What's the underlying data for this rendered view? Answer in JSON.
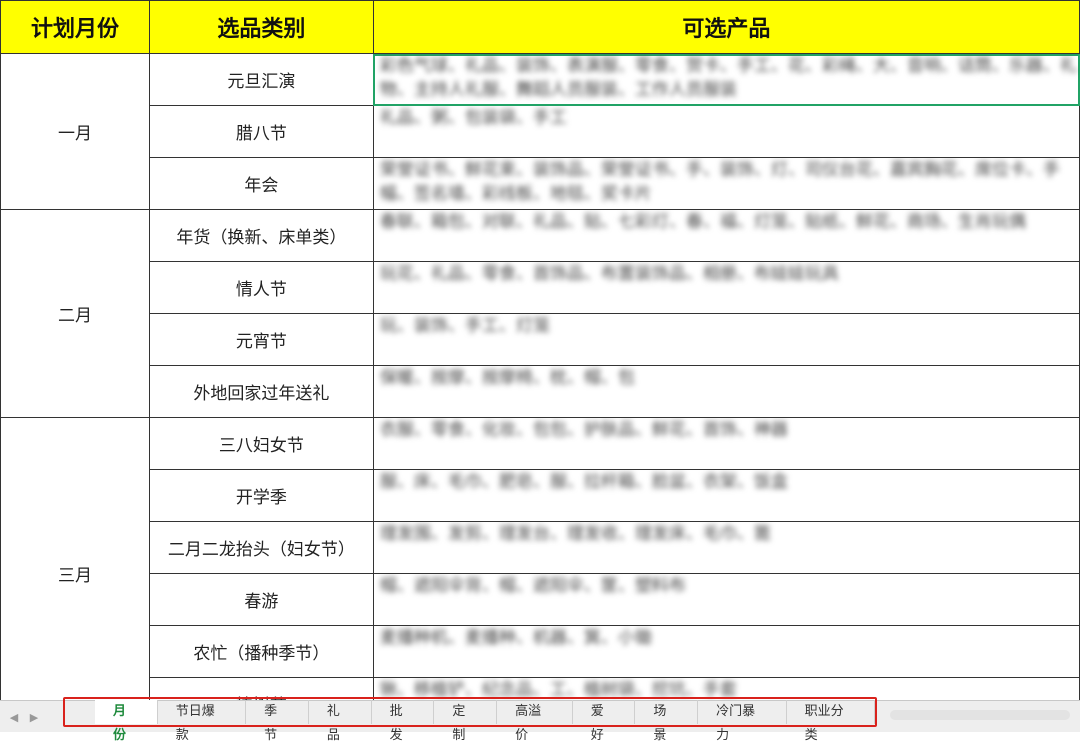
{
  "header": {
    "col_month": "计划月份",
    "col_category": "选品类别",
    "col_products": "可选产品"
  },
  "months": [
    "一月",
    "二月",
    "三月"
  ],
  "rows": [
    {
      "category": "元旦汇演",
      "products": "彩色气球、礼品、装饰、表演服、零食、贺卡、手工、花、彩绳、大、音响、话筒、乐器、礼物、主持人礼服、舞蹈人员服装、工作人员服装"
    },
    {
      "category": "腊八节",
      "products": "礼品、粥、包装袋、手工"
    },
    {
      "category": "年会",
      "products": "荣誉证书、鲜花束、装饰品、荣誉证书、手、装饰、灯、司仪台花、嘉宾胸花、席位卡、手幅、签名墙、彩线板、地毯、奖卡片"
    },
    {
      "category": "年货（换新、床单类）",
      "products": "春联、箱包、对联、礼品、贴、七彩灯、春、福、灯笼、贴纸、鲜花、商场、生肖玩偶"
    },
    {
      "category": "情人节",
      "products": "玩花、礼品、零食、首饰品、布置装饰品、相册、布娃娃玩具"
    },
    {
      "category": "元宵节",
      "products": "玩、装饰、手工、灯笼"
    },
    {
      "category": "外地回家过年送礼",
      "products": "保暖、按摩、按摩椅、枕、帽、包"
    },
    {
      "category": "三八妇女节",
      "products": "衣服、零食、化妆、包包、护肤品、鲜花、首饰、神器"
    },
    {
      "category": "开学季",
      "products": "服、床、毛巾、肥皂、服、拉杆箱、脸盆、衣架、饭盒"
    },
    {
      "category": "二月二龙抬头（妇女节）",
      "products": "理发围、发剪、理发台、理发收、理发床、毛巾、篦"
    },
    {
      "category": "春游",
      "products": "帽、遮阳伞背、帽、遮阳伞、筐、塑料布"
    },
    {
      "category": "农忙（播种季节）",
      "products": "麦播种机、麦播种、机器、箕、小锄"
    },
    {
      "category": "植树节",
      "products": "锹、移植铲、纪念品、工、植树袋、挖坑、手套"
    }
  ],
  "tabs": [
    "月份",
    "节日爆款",
    "季节",
    "礼品",
    "批发",
    "定制",
    "高溢价",
    "爱好",
    "场景",
    "冷门暴力",
    "职业分类"
  ],
  "active_tab": "月份",
  "colors": {
    "header_bg": "#ffff00",
    "selection": "#21a366",
    "active_tab_text": "#1e8a3c",
    "highlight_box": "#d9221c"
  }
}
